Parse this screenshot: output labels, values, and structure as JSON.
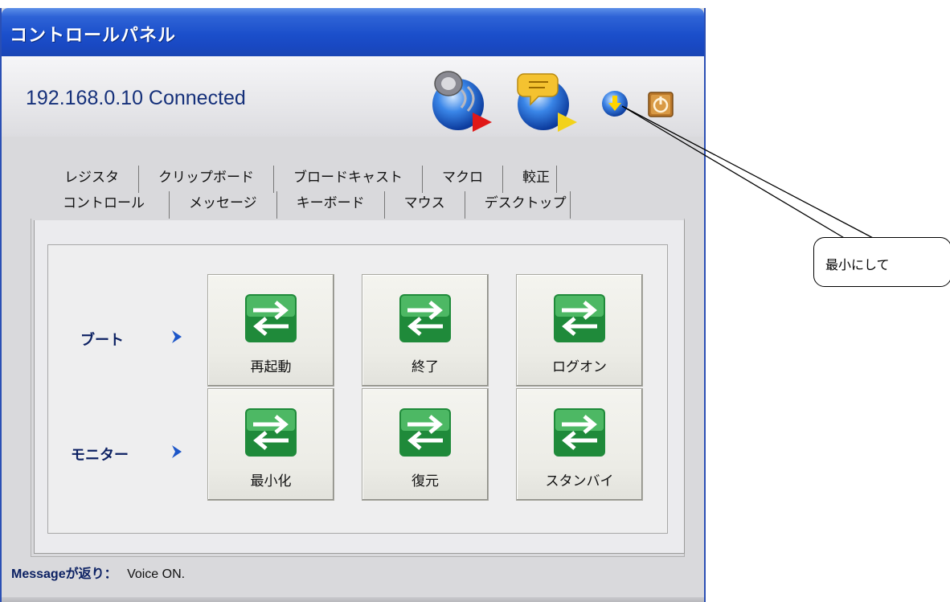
{
  "window": {
    "title": "コントロールパネル",
    "status": "192.168.0.10 Connected"
  },
  "header_icons": [
    "speaker-voice-icon",
    "message-chat-icon",
    "minimize-down-arrow-icon",
    "power-icon"
  ],
  "tabs": {
    "row1": [
      "レジスタ",
      "クリップボード",
      "ブロードキャスト",
      "マクロ",
      "較正"
    ],
    "row2": [
      "コントロール",
      "メッセージ",
      "キーボード",
      "マウス",
      "デスクトップ"
    ],
    "active": "コントロール"
  },
  "groups": [
    {
      "label": "ブート",
      "buttons": [
        "再起動",
        "終了",
        "ログオン"
      ]
    },
    {
      "label": "モニター",
      "buttons": [
        "最小化",
        "復元",
        "スタンバイ"
      ]
    }
  ],
  "message": {
    "label": "Messageが返り：",
    "value": "Voice ON."
  },
  "callout": {
    "text": "最小にして"
  },
  "colors": {
    "titlebar": "#1b4fcb",
    "status_text": "#15307a",
    "button_icon_green": "#1f8a3a"
  }
}
